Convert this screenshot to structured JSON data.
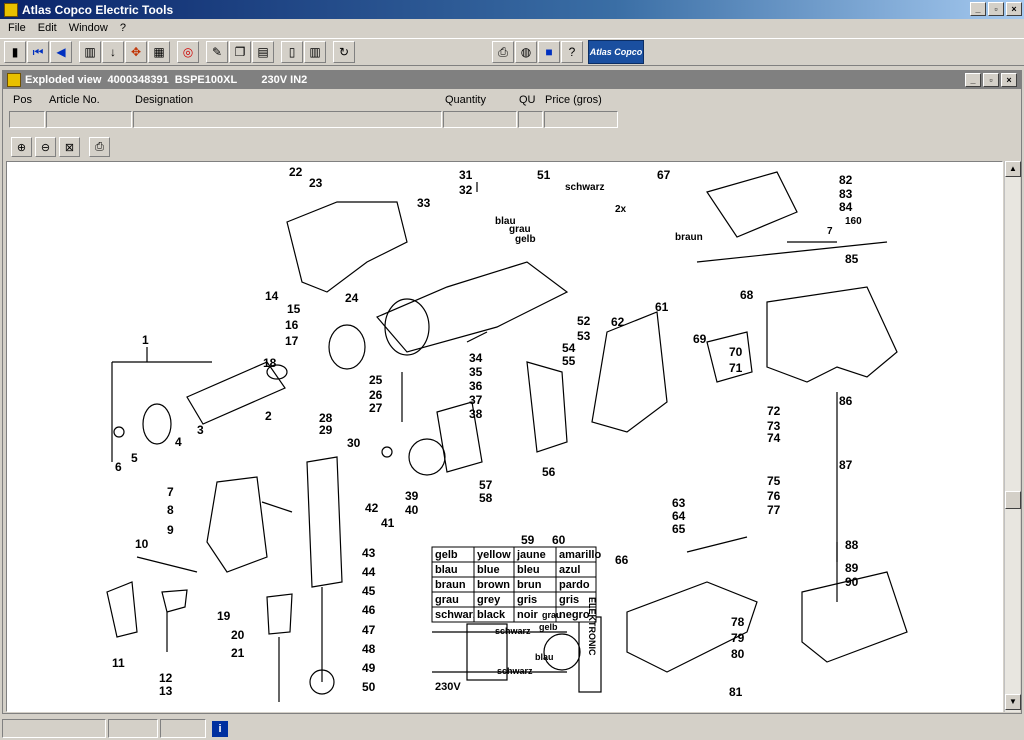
{
  "app": {
    "title": "Atlas Copco Electric Tools",
    "menu": [
      "File",
      "Edit",
      "Window",
      "?"
    ],
    "logo_text": "Atlas Copco"
  },
  "child": {
    "title": "Exploded view  4000348391  BSPE100XL        230V IN2",
    "columns": {
      "pos": "Pos",
      "article": "Article No.",
      "designation": "Designation",
      "quantity": "Quantity",
      "qu": "QU",
      "price": "Price (gros)"
    }
  },
  "diagram": {
    "part_numbers": [
      "1",
      "2",
      "3",
      "4",
      "5",
      "6",
      "7",
      "8",
      "9",
      "10",
      "11",
      "12",
      "13",
      "14",
      "15",
      "16",
      "17",
      "18",
      "19",
      "20",
      "21",
      "22",
      "23",
      "24",
      "25",
      "26",
      "27",
      "28",
      "29",
      "30",
      "31",
      "32",
      "33",
      "34",
      "35",
      "36",
      "37",
      "38",
      "39",
      "40",
      "41",
      "42",
      "43",
      "44",
      "45",
      "46",
      "47",
      "48",
      "49",
      "50",
      "51",
      "52",
      "53",
      "54",
      "55",
      "56",
      "57",
      "58",
      "59",
      "60",
      "61",
      "62",
      "63",
      "64",
      "65",
      "66",
      "67",
      "68",
      "69",
      "70",
      "71",
      "72",
      "73",
      "74",
      "75",
      "76",
      "77",
      "78",
      "79",
      "80",
      "81",
      "82",
      "83",
      "84",
      "85",
      "86",
      "87",
      "88",
      "89",
      "90"
    ],
    "wire_labels": [
      "schwarz",
      "blau",
      "grau",
      "gelb",
      "braun",
      "2x",
      "160",
      "7"
    ],
    "color_table": [
      [
        "gelb",
        "yellow",
        "jaune",
        "amarillo"
      ],
      [
        "blau",
        "blue",
        "bleu",
        "azul"
      ],
      [
        "braun",
        "brown",
        "brun",
        "pardo"
      ],
      [
        "grau",
        "grey",
        "gris",
        "gris"
      ],
      [
        "schwarz",
        "black",
        "noir",
        "negro"
      ]
    ],
    "wiring": {
      "voltage": "230V",
      "wires": [
        "schwarz",
        "gelb",
        "grau",
        "blau",
        "schwarz"
      ],
      "module": "ELEKTRONIC"
    }
  }
}
